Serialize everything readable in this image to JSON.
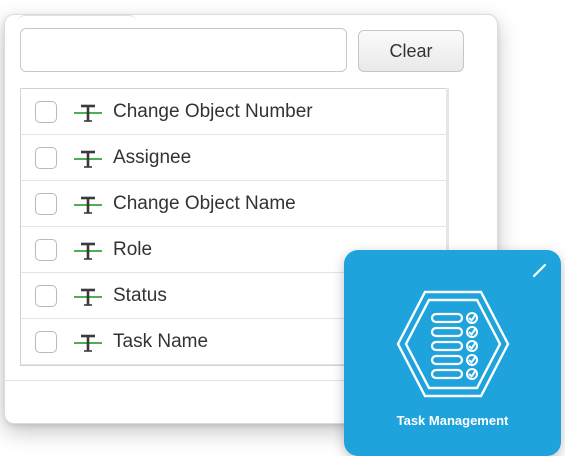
{
  "search": {
    "value": "",
    "placeholder": ""
  },
  "clear_label": "Clear",
  "fields": [
    {
      "label": "Change Object Number",
      "checked": false,
      "icon": "text-field-icon"
    },
    {
      "label": "Assignee",
      "checked": false,
      "icon": "text-field-icon"
    },
    {
      "label": "Change Object Name",
      "checked": false,
      "icon": "text-field-icon"
    },
    {
      "label": "Role",
      "checked": false,
      "icon": "text-field-icon"
    },
    {
      "label": "Status",
      "checked": false,
      "icon": "text-field-icon"
    },
    {
      "label": "Task Name",
      "checked": false,
      "icon": "text-field-icon"
    }
  ],
  "tile": {
    "label": "Task Management",
    "icon": "task-list-icon",
    "edit_icon": "pencil-icon",
    "background": "#1ea3dd"
  },
  "colors": {
    "text_field_icon": "#3a3a3a",
    "text_field_icon_accent": "#4caf50"
  }
}
